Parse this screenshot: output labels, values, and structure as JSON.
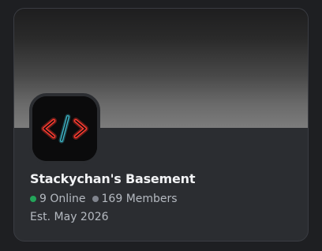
{
  "server": {
    "name": "Stackychan's Basement",
    "online_count": "9 Online",
    "member_count": "169 Members",
    "established": "Est. May 2026",
    "icon": "code-brackets-neon-icon"
  },
  "colors": {
    "online": "#23a55a",
    "members": "#80848e",
    "card": "#2b2d31",
    "icon_bracket": "#ff3b30",
    "icon_slash": "#3fb7c9"
  }
}
